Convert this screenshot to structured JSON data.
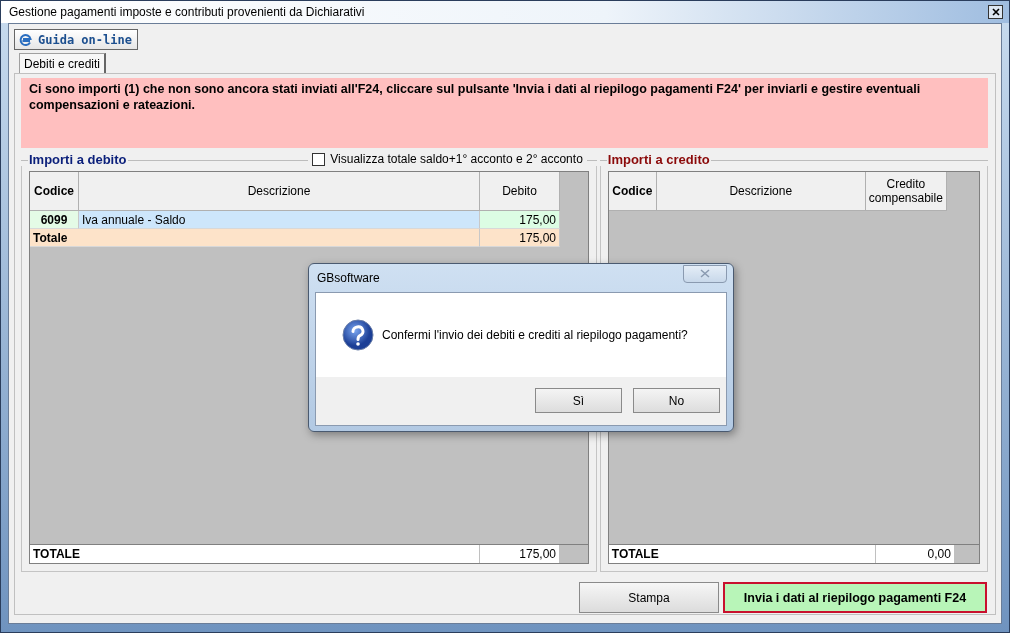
{
  "window": {
    "title": "Gestione pagamenti imposte e contributi provenienti da Dichiarativi"
  },
  "guide_button": {
    "label": "Guida on-line"
  },
  "tabs": [
    {
      "label": "Debiti e crediti",
      "selected": true
    }
  ],
  "banner": {
    "text": "Ci sono importi (1) che non sono ancora stati inviati all'F24, cliccare sul pulsante 'Invia i dati al riepilogo pagamenti F24' per inviarli e gestire eventuali compensazioni e rateazioni."
  },
  "debit_panel": {
    "title": "Importi a debito",
    "checkbox": {
      "label": "Visualizza totale saldo+1° acconto e 2° acconto",
      "checked": false
    },
    "columns": [
      "Codice",
      "Descrizione",
      "Debito"
    ],
    "rows": [
      {
        "code": "6099",
        "description": "Iva annuale - Saldo",
        "amount": "175,00"
      }
    ],
    "subtotal": {
      "label": "Totale",
      "value": "175,00"
    },
    "footer": {
      "label": "TOTALE",
      "value": "175,00"
    }
  },
  "credit_panel": {
    "title": "Importi a credito",
    "columns": [
      "Codice",
      "Descrizione",
      "Credito compensabile"
    ],
    "footer": {
      "label": "TOTALE",
      "value": "0,00"
    }
  },
  "buttons": [
    {
      "label": "Stampa",
      "kind": "normal"
    },
    {
      "label": "Invia i dati al riepilogo pagamenti F24",
      "kind": "primary"
    }
  ],
  "dialog": {
    "title": "GBsoftware",
    "message": "Confermi l'invio dei debiti e crediti al riepilogo pagamenti?",
    "buttons": [
      "Sì",
      "No"
    ]
  }
}
